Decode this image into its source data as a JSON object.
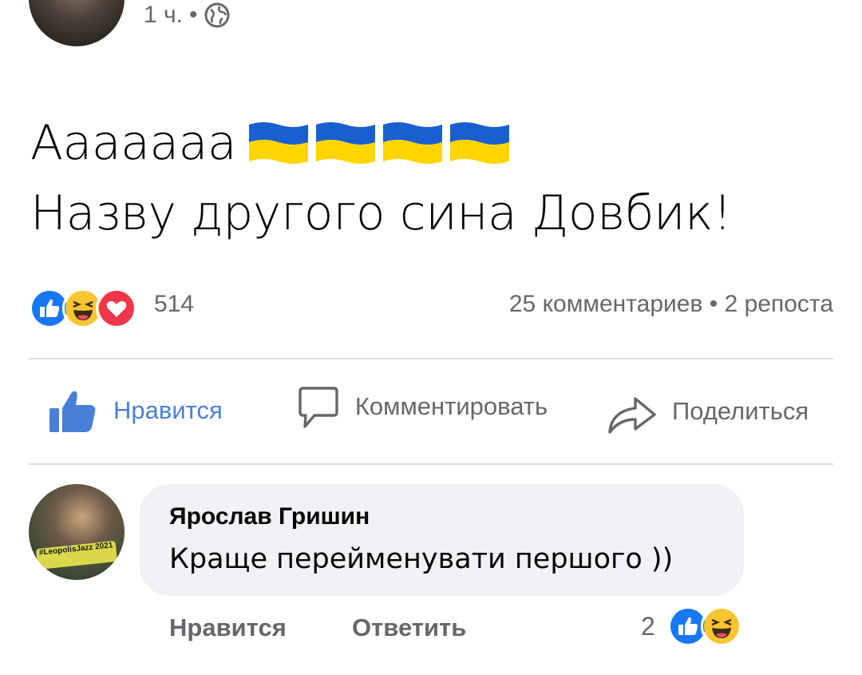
{
  "header": {
    "time": "1 ч.",
    "separator": "•",
    "privacy_icon": "globe-icon"
  },
  "post": {
    "line1": "Аааааaa",
    "flags": [
      "ukraine-flag",
      "ukraine-flag",
      "ukraine-flag",
      "ukraine-flag"
    ],
    "line2": "Назву другого сина Довбик!"
  },
  "reactions": {
    "icons": [
      "like-icon",
      "haha-icon",
      "love-icon"
    ],
    "count": "514"
  },
  "stats": {
    "comments": "25 комментариев",
    "separator": "•",
    "shares": "2 репоста"
  },
  "actions": {
    "like": "Нравится",
    "comment": "Комментировать",
    "share": "Поделиться"
  },
  "comment": {
    "author": "Ярослав Гришин",
    "text": "Краще перейменувати першого ))",
    "avatar_badge": "#LeopolisJazz 2021",
    "like": "Нравится",
    "reply": "Ответить",
    "reaction_count": "2",
    "reaction_icons": [
      "like-icon",
      "haha-icon"
    ]
  },
  "colors": {
    "like_blue": "#4a7fd8",
    "flag_blue": "#1a5fd0",
    "flag_yellow": "#ffd500",
    "bubble_bg": "#f0f2f5",
    "muted_text": "#65676b"
  }
}
